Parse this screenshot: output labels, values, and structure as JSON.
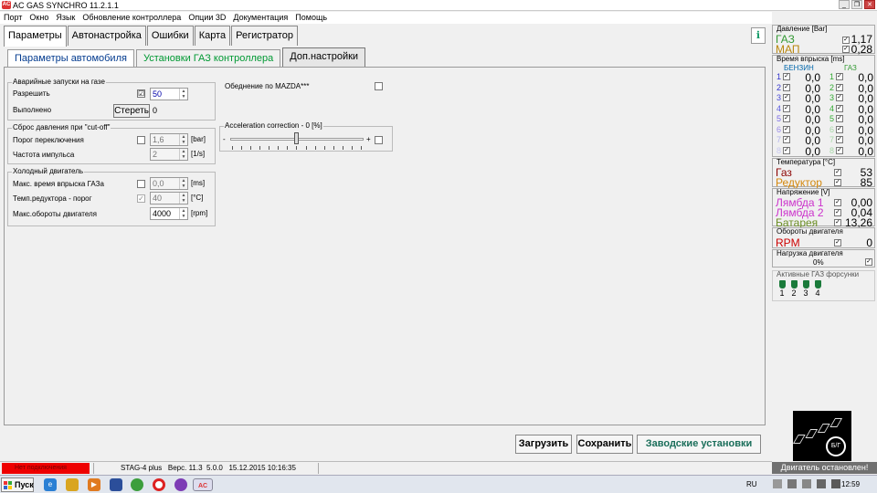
{
  "window": {
    "title": "AC GAS SYNCHRO  11.2.1.1",
    "min": "_",
    "restore": "❐",
    "close": "✕"
  },
  "menu": [
    "Порт",
    "Окно",
    "Язык",
    "Обновление контроллера",
    "Опции 3D",
    "Документация",
    "Помощь"
  ],
  "main_tabs": [
    "Параметры",
    "Автонастройка",
    "Ошибки",
    "Карта",
    "Регистратор"
  ],
  "sub_tabs": [
    "Параметры автомобиля",
    "Установки ГАЗ контроллера",
    "Доп.настройки"
  ],
  "emergency": {
    "title": "Аварийные запуски на газе",
    "allow_label": "Разрешить",
    "allow_checked": "☑",
    "allow_value": "50",
    "done_label": "Выполнено",
    "erase_button": "Стереть",
    "done_value": "0"
  },
  "cutoff": {
    "title": "Сброс давления при \"cut-off\"",
    "threshold_label": "Порог переключения",
    "threshold_value": "1,6",
    "threshold_unit": "[bar]",
    "pulse_label": "Частота импульса",
    "pulse_value": "2",
    "pulse_unit": "[1/s]"
  },
  "cold": {
    "title": "Холодный двигатель",
    "max_time_label": "Макс. время впрыска ГАЗа",
    "max_time_value": "0,0",
    "max_time_unit": "[ms]",
    "reducer_label": "Темп.редуктора - порог",
    "reducer_value": "40",
    "reducer_unit": "[°C]",
    "rpm_label": "Макс.обороты двигателя",
    "rpm_value": "4000",
    "rpm_unit": "[rpm]"
  },
  "mazda": {
    "label": "Обеднение по MAZDA***"
  },
  "accel": {
    "title": "Acceleration correction - 0 [%]",
    "minus": "-",
    "plus": "+",
    "level_percent": 0
  },
  "buttons": {
    "load": "Загрузить",
    "save": "Сохранить",
    "factory": "Заводские установки"
  },
  "status": {
    "connection": "Нет подключения",
    "device": "STAG-4 plus",
    "version_label": "Верс.",
    "version": "11.3",
    "fw": "5.0.0",
    "date": "15.12.2015 10:16:35"
  },
  "pressure": {
    "title": "Давление [Bar]",
    "gas_label": "ГАЗ",
    "gas_value": "1,17",
    "map_label": "МАП",
    "map_value": "0,28"
  },
  "injection": {
    "title": "Время впрыска [ms]",
    "petrol_header": "БЕНЗИН",
    "gas_header": "ГАЗ",
    "rows": [
      {
        "n": "1",
        "petrol": "0,0",
        "gas": "0,0",
        "color": "#3333cc"
      },
      {
        "n": "2",
        "petrol": "0,0",
        "gas": "0,0",
        "color": "#3333cc"
      },
      {
        "n": "3",
        "petrol": "0,0",
        "gas": "0,0",
        "color": "#4a4ad6"
      },
      {
        "n": "4",
        "petrol": "0,0",
        "gas": "0,0",
        "color": "#5a5ae0"
      },
      {
        "n": "5",
        "petrol": "0,0",
        "gas": "0,0",
        "color": "#7a6ae6"
      },
      {
        "n": "6",
        "petrol": "0,0",
        "gas": "0,0",
        "color": "#9a8ae8"
      },
      {
        "n": "7",
        "petrol": "0,0",
        "gas": "0,0",
        "color": "#b0b0ec"
      },
      {
        "n": "8",
        "petrol": "0,0",
        "gas": "0,0",
        "color": "#c8c8f0"
      }
    ]
  },
  "temperature": {
    "title": "Температура [°C]",
    "gas_label": "Газ",
    "gas_value": "53",
    "reducer_label": "Редуктор",
    "reducer_value": "85"
  },
  "voltage": {
    "title": "Напряжение [V]",
    "lambda1_label": "Лямбда 1",
    "lambda1_value": "0,00",
    "lambda2_label": "Лямбда 2",
    "lambda2_value": "0,04",
    "battery_label": "Батарея",
    "battery_value": "13,26"
  },
  "rpm": {
    "title": "Обороты двигателя",
    "label": "RPM",
    "value": "0"
  },
  "load": {
    "title": "Нагрузка двигателя",
    "value": "0%"
  },
  "active_injectors": {
    "title": "Активные ГАЗ форсунки",
    "items": [
      "1",
      "2",
      "3",
      "4"
    ]
  },
  "engine_status": "Двигатель остановлен!",
  "switch_label": "Б/Г",
  "taskbar": {
    "start": "Пуск",
    "lang": "RU",
    "time": "12:59"
  },
  "colors": {
    "pressure_gas": "#339933",
    "pressure_map": "#b8860b",
    "temp_gas": "#8b0000",
    "temp_reducer": "#d4880e",
    "lambda": "#cc33cc",
    "battery": "#6b8e23",
    "rpm": "#cc0000",
    "conn_bg": "#ee0000"
  }
}
